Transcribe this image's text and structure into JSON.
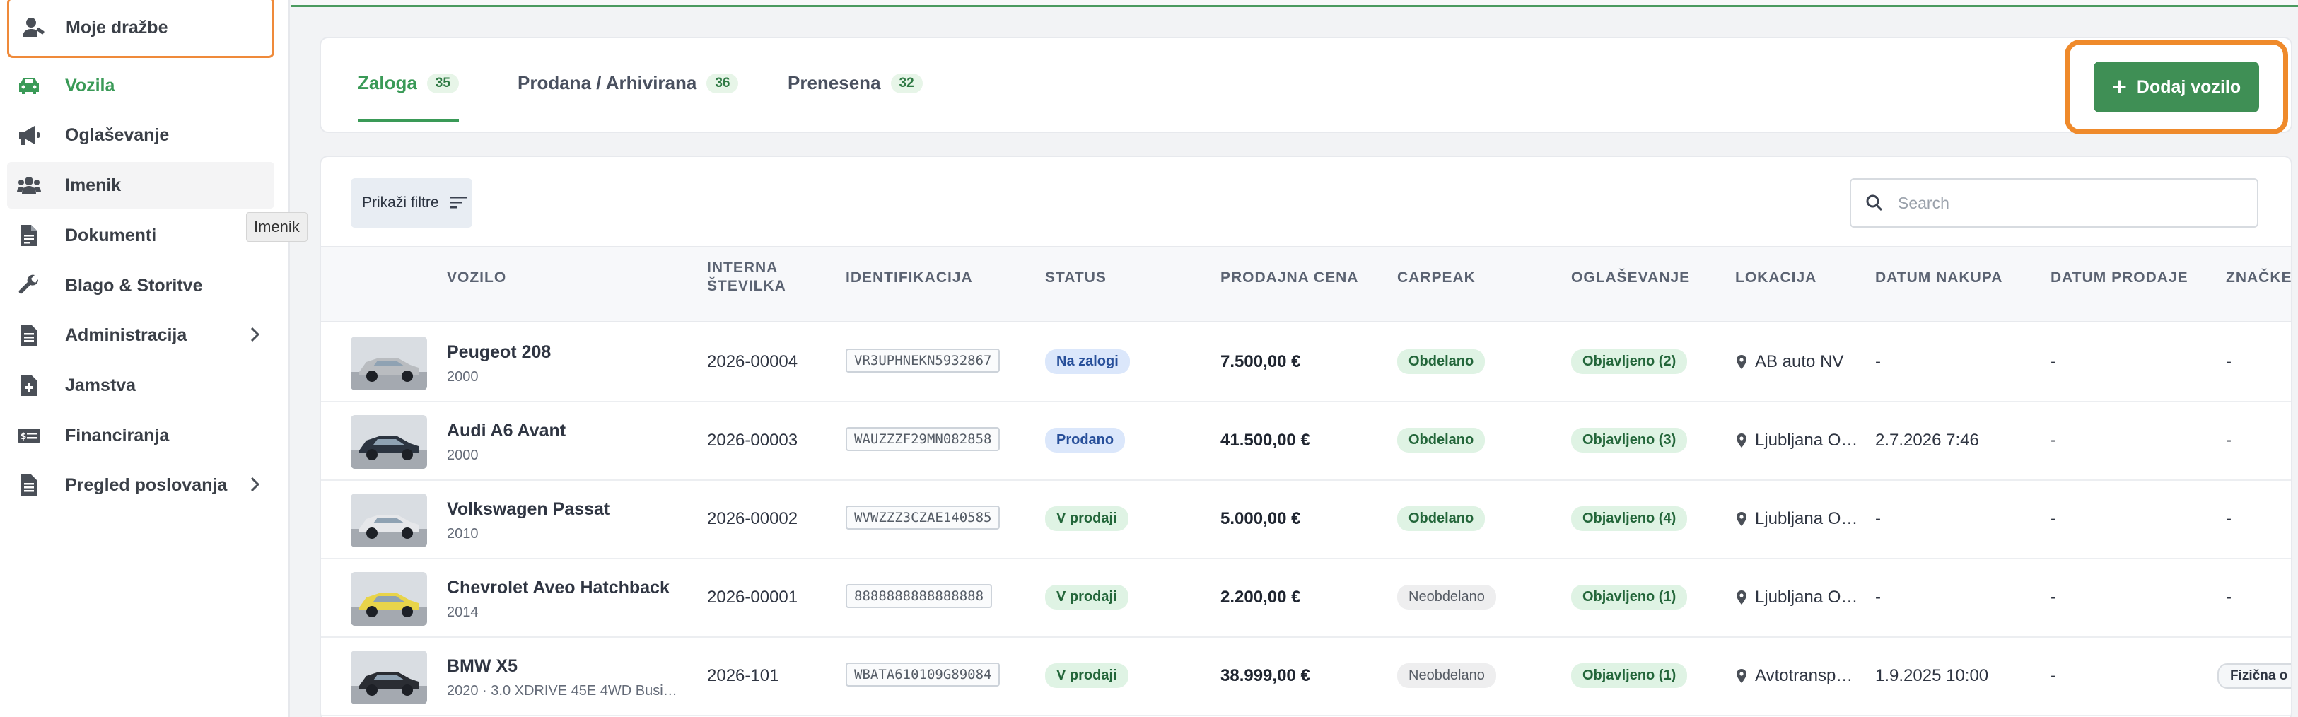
{
  "sidebar": {
    "top_item": {
      "label": "Moje dražbe",
      "icon": "user-gavel-icon"
    },
    "items": [
      {
        "label": "Vozila",
        "icon": "car-icon",
        "active": true
      },
      {
        "label": "Oglaševanje",
        "icon": "megaphone-icon"
      },
      {
        "label": "Imenik",
        "icon": "users-icon",
        "hover": true
      },
      {
        "label": "Dokumenti",
        "icon": "document-icon"
      },
      {
        "label": "Blago & Storitve",
        "icon": "wrench-icon"
      },
      {
        "label": "Administracija",
        "icon": "clipboard-icon",
        "has_children": true
      },
      {
        "label": "Jamstva",
        "icon": "file-plus-icon"
      },
      {
        "label": "Financiranja",
        "icon": "money-card-icon"
      },
      {
        "label": "Pregled poslovanja",
        "icon": "report-icon",
        "has_children": true
      }
    ],
    "tooltip": "Imenik"
  },
  "tabs": [
    {
      "label": "Zaloga",
      "count": "35",
      "active": true
    },
    {
      "label": "Prodana / Arhivirana",
      "count": "36"
    },
    {
      "label": "Prenesena",
      "count": "32"
    }
  ],
  "add_button": {
    "label": "Dodaj vozilo"
  },
  "filter_button": {
    "label": "Prikaži filtre"
  },
  "search": {
    "placeholder": "Search",
    "value": ""
  },
  "columns": {
    "vehicle": "VOZILO",
    "internal": "INTERNA ŠTEVILKA",
    "ident": "IDENTIFIKACIJA",
    "status": "STATUS",
    "price": "PRODAJNA CENA",
    "carpeak": "CARPEAK",
    "ads": "OGLAŠEVANJE",
    "location": "LOKACIJA",
    "buy_date": "DATUM NAKUPA",
    "sell_date": "DATUM PRODAJE",
    "tags": "ZNAČKE"
  },
  "rows": [
    {
      "name": "Peugeot 208",
      "sub": "2000",
      "internal": "2026-00004",
      "vin": "VR3UPHNEKN5932867",
      "status": "Na zalogi",
      "status_color": "blue",
      "price": "7.500,00 €",
      "carpeak": "Obdelano",
      "carpeak_color": "green",
      "ads": "Objavljeno (2)",
      "location": "AB auto NV",
      "buy_date": "-",
      "sell_date": "-",
      "tags": "-",
      "car_color": "#b9bcc0"
    },
    {
      "name": "Audi A6 Avant",
      "sub": "2000",
      "internal": "2026-00003",
      "vin": "WAUZZZF29MN082858",
      "status": "Prodano",
      "status_color": "blue",
      "price": "41.500,00 €",
      "carpeak": "Obdelano",
      "carpeak_color": "green",
      "ads": "Objavljeno (3)",
      "location": "Ljubljana O…",
      "buy_date": "2.7.2026 7:46",
      "sell_date": "-",
      "tags": "-",
      "car_color": "#2c3440"
    },
    {
      "name": "Volkswagen Passat",
      "sub": "2010",
      "internal": "2026-00002",
      "vin": "WVWZZZ3CZAE140585",
      "status": "V prodaji",
      "status_color": "green",
      "price": "5.000,00 €",
      "carpeak": "Obdelano",
      "carpeak_color": "green",
      "ads": "Objavljeno (4)",
      "location": "Ljubljana O…",
      "buy_date": "-",
      "sell_date": "-",
      "tags": "-",
      "car_color": "#e6e7ea"
    },
    {
      "name": "Chevrolet Aveo Hatchback",
      "sub": "2014",
      "internal": "2026-00001",
      "vin": "8888888888888888",
      "status": "V prodaji",
      "status_color": "green",
      "price": "2.200,00 €",
      "carpeak": "Neobdelano",
      "carpeak_color": "gray",
      "ads": "Objavljeno (1)",
      "location": "Ljubljana O…",
      "buy_date": "-",
      "sell_date": "-",
      "tags": "-",
      "car_color": "#e8d44a"
    },
    {
      "name": "BMW X5",
      "sub": "2020 · 3.0 XDRIVE 45E 4WD Busi…",
      "internal": "2026-101",
      "vin": "WBATA610109G89084",
      "status": "V prodaji",
      "status_color": "green",
      "price": "38.999,00 €",
      "carpeak": "Neobdelano",
      "carpeak_color": "gray",
      "ads": "Objavljeno (1)",
      "location": "Avtotransp…",
      "buy_date": "1.9.2025 10:00",
      "sell_date": "-",
      "tags": "Fizična o",
      "car_color": "#2a2d33"
    }
  ]
}
